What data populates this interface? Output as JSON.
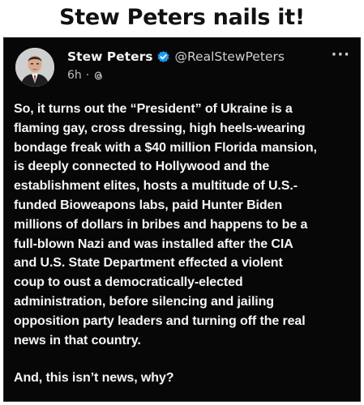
{
  "headline": "Stew Peters nails it!",
  "post": {
    "display_name": "Stew Peters",
    "handle": "@RealStewPeters",
    "time": "6h",
    "separator": "·",
    "more_label": "···",
    "paragraphs": [
      "So, it turns out the “President” of Ukraine is a\nflaming gay, cross dressing, high heels-wearing\nbondage freak with a $40 million Florida mansion,\nis deeply connected to Hollywood and the\nestablishment elites, hosts a multitude of U.S.-\nfunded Bioweapons labs, paid Hunter Biden\nmillions of dollars in bribes and happens to be a\nfull-blown Nazi and was installed after the CIA\nand U.S. State Department effected a violent\ncoup to oust a democratically-elected\nadministration, before silencing and jailing\nopposition party leaders and turning off the real\nnews in that country.",
      "And, this isn’t news, why?"
    ]
  },
  "icons": {
    "verified": "verified-badge-icon",
    "threads": "threads-icon",
    "more": "more-options-icon"
  },
  "colors": {
    "card_bg": "#070707",
    "text": "#f5f5f5",
    "muted": "#bdbdbd",
    "verified_blue": "#1d9bf0"
  }
}
